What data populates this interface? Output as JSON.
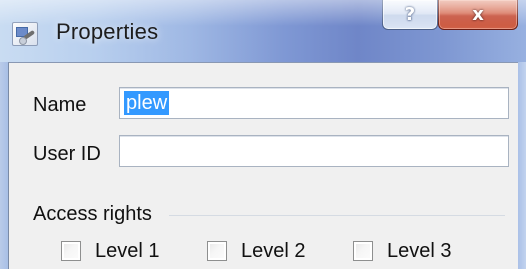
{
  "window": {
    "title": "Properties",
    "help_glyph": "?",
    "close_glyph": "x"
  },
  "form": {
    "name_label": "Name",
    "name_value": "plew",
    "userid_label": "User ID",
    "userid_value": ""
  },
  "access": {
    "heading": "Access rights",
    "levels": [
      {
        "label": "Level 1",
        "checked": false
      },
      {
        "label": "Level 2",
        "checked": false
      },
      {
        "label": "Level 3",
        "checked": false
      }
    ]
  },
  "colors": {
    "selection": "#3399ff",
    "close_button": "#c2432c",
    "client_bg": "#f0f0f0"
  }
}
